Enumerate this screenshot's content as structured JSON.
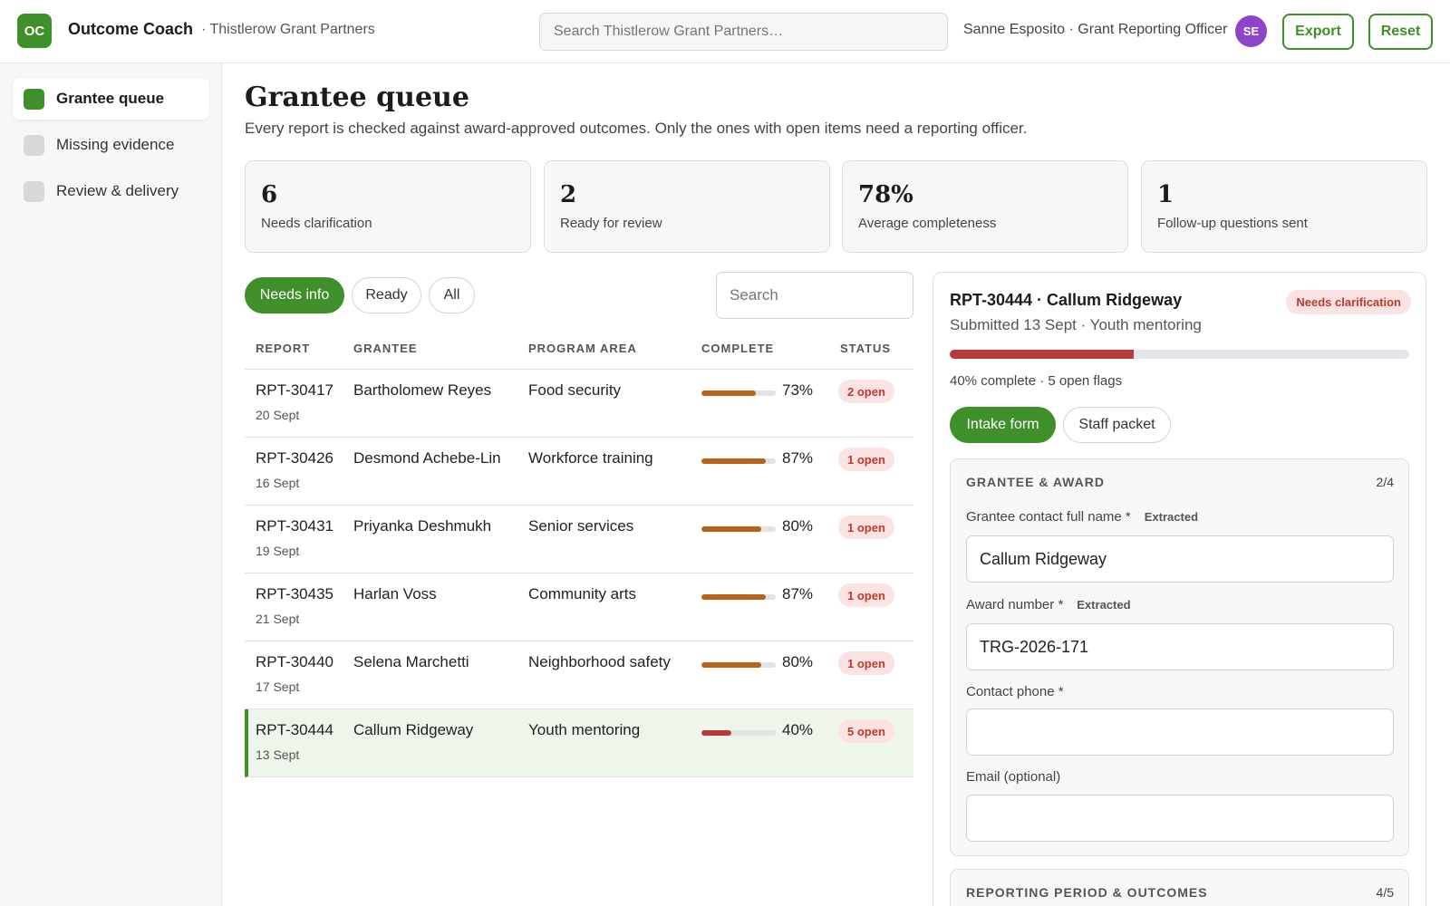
{
  "app": {
    "logo_text": "OC",
    "name": "Outcome Coach",
    "org": "· Thistlerow Grant Partners",
    "search_placeholder": "Search Thistlerow Grant Partners…",
    "user_label": "Sanne Esposito · Grant Reporting Officer",
    "avatar_initials": "SE",
    "export_label": "Export",
    "reset_label": "Reset"
  },
  "sidebar": {
    "items": [
      {
        "label": "Grantee queue",
        "active": true
      },
      {
        "label": "Missing evidence",
        "active": false
      },
      {
        "label": "Review & delivery",
        "active": false
      }
    ]
  },
  "page": {
    "title": "Grantee queue",
    "subtitle": "Every report is checked against award-approved outcomes. Only the ones with open items need a reporting officer."
  },
  "stats": [
    {
      "value": "6",
      "label": "Needs clarification"
    },
    {
      "value": "2",
      "label": "Ready for review"
    },
    {
      "value": "78%",
      "label": "Average completeness"
    },
    {
      "value": "1",
      "label": "Follow-up questions sent"
    }
  ],
  "filters": {
    "pills": [
      "Needs info",
      "Ready",
      "All"
    ],
    "active": "Needs info",
    "search_placeholder": "Search"
  },
  "table": {
    "columns": [
      "REPORT",
      "GRANTEE",
      "PROGRAM AREA",
      "COMPLETE",
      "STATUS"
    ],
    "rows": [
      {
        "report": "RPT-30417",
        "date": "20 Sept",
        "grantee": "Bartholomew Reyes",
        "program": "Food security",
        "complete": 73,
        "complete_label": "73%",
        "status": "2 open",
        "selected": false
      },
      {
        "report": "RPT-30426",
        "date": "16 Sept",
        "grantee": "Desmond Achebe-Lin",
        "program": "Workforce training",
        "complete": 87,
        "complete_label": "87%",
        "status": "1 open",
        "selected": false
      },
      {
        "report": "RPT-30431",
        "date": "19 Sept",
        "grantee": "Priyanka Deshmukh",
        "program": "Senior services",
        "complete": 80,
        "complete_label": "80%",
        "status": "1 open",
        "selected": false
      },
      {
        "report": "RPT-30435",
        "date": "21 Sept",
        "grantee": "Harlan Voss",
        "program": "Community arts",
        "complete": 87,
        "complete_label": "87%",
        "status": "1 open",
        "selected": false
      },
      {
        "report": "RPT-30440",
        "date": "17 Sept",
        "grantee": "Selena Marchetti",
        "program": "Neighborhood safety",
        "complete": 80,
        "complete_label": "80%",
        "status": "1 open",
        "selected": false
      },
      {
        "report": "RPT-30444",
        "date": "13 Sept",
        "grantee": "Callum Ridgeway",
        "program": "Youth mentoring",
        "complete": 40,
        "complete_label": "40%",
        "status": "5 open",
        "selected": true
      }
    ]
  },
  "detail": {
    "title": "RPT-30444 · Callum Ridgeway",
    "status": "Needs clarification",
    "subtitle": "Submitted 13 Sept · Youth mentoring",
    "progress": 40,
    "progress_text": "40% complete · 5 open flags",
    "tabs": [
      "Intake form",
      "Staff packet"
    ],
    "active_tab": "Intake form",
    "sections": [
      {
        "title": "GRANTEE & AWARD",
        "count": "2/4",
        "fields": [
          {
            "label": "Grantee contact full name *",
            "tag": "Extracted",
            "value": ""
          },
          {
            "label": "Award number *",
            "tag": "Extracted",
            "value": ""
          },
          {
            "label": "Contact phone *",
            "tag": "",
            "value": ""
          },
          {
            "label": "Email (optional)",
            "tag": "",
            "value": ""
          }
        ],
        "values": [
          "Callum Ridgeway",
          "TRG-2026-171",
          "",
          ""
        ]
      },
      {
        "title": "REPORTING PERIOD & OUTCOMES",
        "count": "4/5"
      }
    ]
  },
  "colors": {
    "brand": "#3f8f2a",
    "bar_ok": "#b8621b",
    "bar_low": "#b83b3b",
    "badge_bg": "#fbe3e3",
    "badge_text": "#c0392b",
    "avatar": "#8e44c9"
  }
}
